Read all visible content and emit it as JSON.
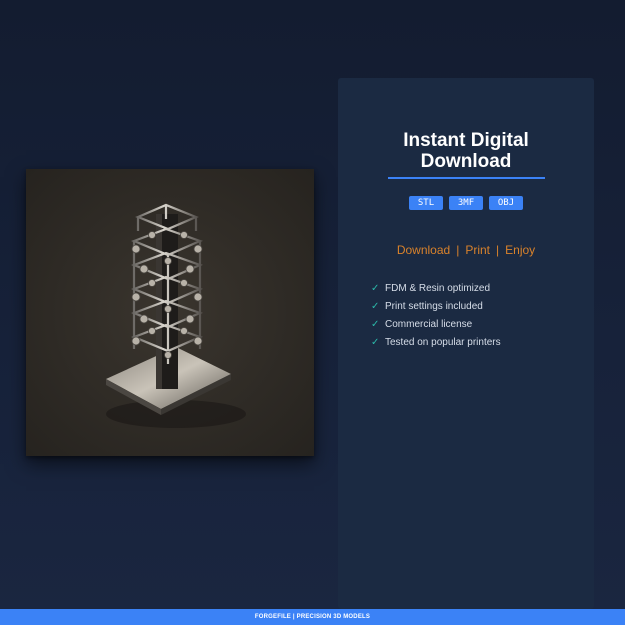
{
  "product": {
    "image_alt": "3D printed lattice tower model"
  },
  "panel": {
    "title_line1": "Instant Digital",
    "title_line2": "Download",
    "formats": [
      "STL",
      "3MF",
      "OBJ"
    ],
    "tagline": {
      "download": "Download",
      "print": "Print",
      "enjoy": "Enjoy",
      "separator": "|"
    },
    "features": [
      "FDM & Resin optimized",
      "Print settings included",
      "Commercial license",
      "Tested on popular printers"
    ],
    "check_icon": "✓"
  },
  "footer": {
    "text": "FORGEFILE | PRECISION 3D MODELS"
  },
  "colors": {
    "accent": "#3b82f6",
    "tagline": "#d9822b",
    "check": "#2bb7a8",
    "panel_bg": "#1b2a42",
    "page_bg": "#131c30"
  }
}
